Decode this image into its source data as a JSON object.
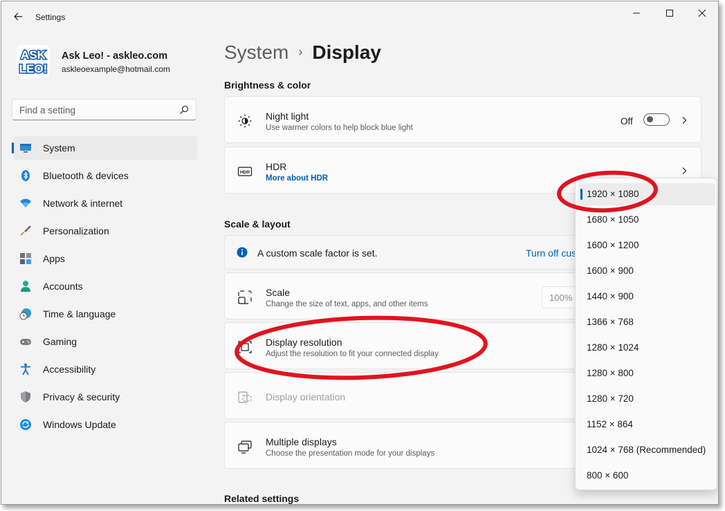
{
  "window": {
    "title": "Settings",
    "controls": {
      "minimize": "minimize",
      "maximize": "maximize",
      "close": "close"
    }
  },
  "account": {
    "avatar_text_top": "ASK",
    "avatar_text_bottom": "LEO!",
    "name": "Ask Leo! - askleo.com",
    "email": "askleoexample@hotmail.com"
  },
  "search": {
    "placeholder": "Find a setting"
  },
  "nav": {
    "items": [
      {
        "label": "System",
        "icon": "monitor-icon",
        "selected": true
      },
      {
        "label": "Bluetooth & devices",
        "icon": "bluetooth-icon"
      },
      {
        "label": "Network & internet",
        "icon": "wifi-icon"
      },
      {
        "label": "Personalization",
        "icon": "brush-icon"
      },
      {
        "label": "Apps",
        "icon": "apps-icon"
      },
      {
        "label": "Accounts",
        "icon": "person-icon"
      },
      {
        "label": "Time & language",
        "icon": "globe-clock-icon"
      },
      {
        "label": "Gaming",
        "icon": "gamepad-icon"
      },
      {
        "label": "Accessibility",
        "icon": "accessibility-icon"
      },
      {
        "label": "Privacy & security",
        "icon": "shield-icon"
      },
      {
        "label": "Windows Update",
        "icon": "update-icon"
      }
    ]
  },
  "breadcrumb": {
    "parent": "System",
    "separator": "›",
    "current": "Display"
  },
  "sections": {
    "brightness": "Brightness & color",
    "scale_layout": "Scale & layout",
    "related": "Related settings"
  },
  "cards": {
    "night_light": {
      "title": "Night light",
      "subtitle": "Use warmer colors to help block blue light",
      "state": "Off"
    },
    "hdr": {
      "title": "HDR",
      "link": "More about HDR"
    },
    "info": {
      "message": "A custom scale factor is set.",
      "action": "Turn off cus"
    },
    "scale": {
      "title": "Scale",
      "subtitle": "Change the size of text, apps, and other items",
      "value": "100%"
    },
    "resolution": {
      "title": "Display resolution",
      "subtitle": "Adjust the resolution to fit your connected display"
    },
    "orientation": {
      "title": "Display orientation"
    },
    "multiple": {
      "title": "Multiple displays",
      "subtitle": "Choose the presentation mode for your displays"
    }
  },
  "resolution_dropdown": {
    "selected": "1920 × 1080",
    "options": [
      "1920 × 1080",
      "1680 × 1050",
      "1600 × 1200",
      "1600 × 900",
      "1440 × 900",
      "1366 × 768",
      "1280 × 1024",
      "1280 × 800",
      "1280 × 720",
      "1152 × 864",
      "1024 × 768 (Recommended)",
      "800 × 600"
    ]
  },
  "colors": {
    "accent": "#005fb8",
    "annotation_red": "#e0141e",
    "window_bg": "#f3f3f3",
    "card_bg": "#fbfbfb"
  }
}
